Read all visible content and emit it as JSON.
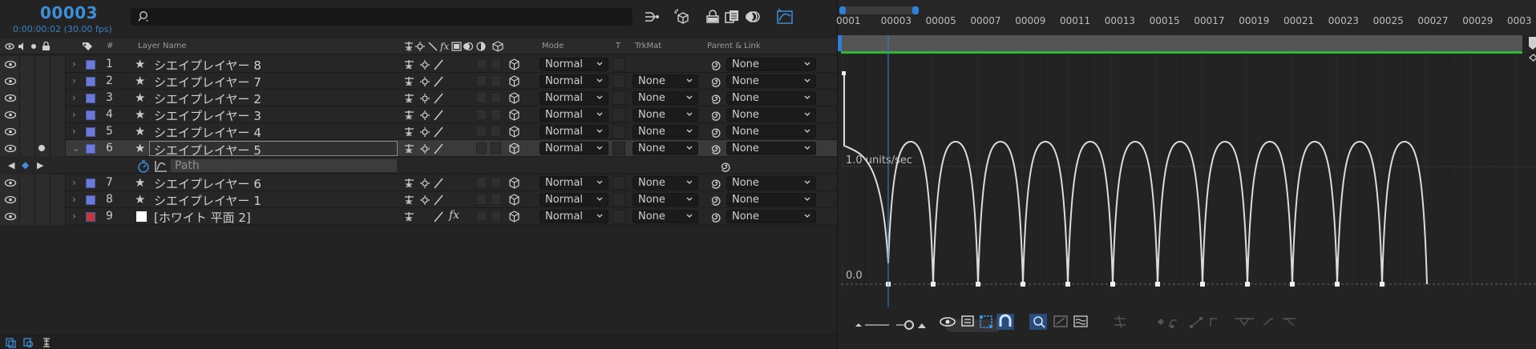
{
  "timecode": {
    "frame": "00003",
    "time": "0:00:00:02 (30.00 fps)"
  },
  "search": {
    "placeholder": ""
  },
  "columns": {
    "layer_name": "Layer Name",
    "num": "#",
    "mode": "Mode",
    "t": "T",
    "trkmat": "TrkMat",
    "parent_link": "Parent & Link"
  },
  "layers": [
    {
      "num": "1",
      "name": "シエイプレイヤー 8",
      "mode": "Normal",
      "trkmat": "",
      "parent": "None",
      "label_color": "#6a7ad8",
      "star": "★"
    },
    {
      "num": "2",
      "name": "シエイプレイヤー 7",
      "mode": "Normal",
      "trkmat": "None",
      "parent": "None",
      "label_color": "#6a7ad8",
      "star": "★"
    },
    {
      "num": "3",
      "name": "シエイプレイヤー 2",
      "mode": "Normal",
      "trkmat": "None",
      "parent": "None",
      "label_color": "#6a7ad8",
      "star": "★"
    },
    {
      "num": "4",
      "name": "シエイプレイヤー 3",
      "mode": "Normal",
      "trkmat": "None",
      "parent": "None",
      "label_color": "#6a7ad8",
      "star": "★"
    },
    {
      "num": "5",
      "name": "シエイプレイヤー 4",
      "mode": "Normal",
      "trkmat": "None",
      "parent": "None",
      "label_color": "#6a7ad8",
      "star": "★"
    },
    {
      "num": "6",
      "name": "シエイプレイヤー 5",
      "mode": "Normal",
      "trkmat": "None",
      "parent": "None",
      "label_color": "#6a7ad8",
      "star": "★"
    },
    {
      "num": "7",
      "name": "シエイプレイヤー 6",
      "mode": "Normal",
      "trkmat": "None",
      "parent": "None",
      "label_color": "#6a7ad8",
      "star": "★"
    },
    {
      "num": "8",
      "name": "シエイプレイヤー 1",
      "mode": "Normal",
      "trkmat": "None",
      "parent": "None",
      "label_color": "#6a7ad8",
      "star": "★"
    },
    {
      "num": "9",
      "name": "[ホワイト 平面 2]",
      "mode": "Normal",
      "trkmat": "None",
      "parent": "None",
      "label_color": "#c0393b",
      "star": ""
    }
  ],
  "property_row": {
    "name": "Path"
  },
  "ruler": {
    "ticks": [
      "0001",
      "00003",
      "00005",
      "00007",
      "00009",
      "00011",
      "00013",
      "00015",
      "00017",
      "00019",
      "00021",
      "00023",
      "00025",
      "00027",
      "00029",
      "0003"
    ]
  },
  "graph": {
    "upper_label": "1.0 units/sec",
    "lower_label": "0.0"
  },
  "colors": {
    "accent": "#3e8ed8",
    "playhead": "#2d84d8",
    "curve": "#d8d8d8",
    "work_green": "#2fb53a",
    "label_blue": "#6a7ad8",
    "label_red": "#c0393b"
  }
}
